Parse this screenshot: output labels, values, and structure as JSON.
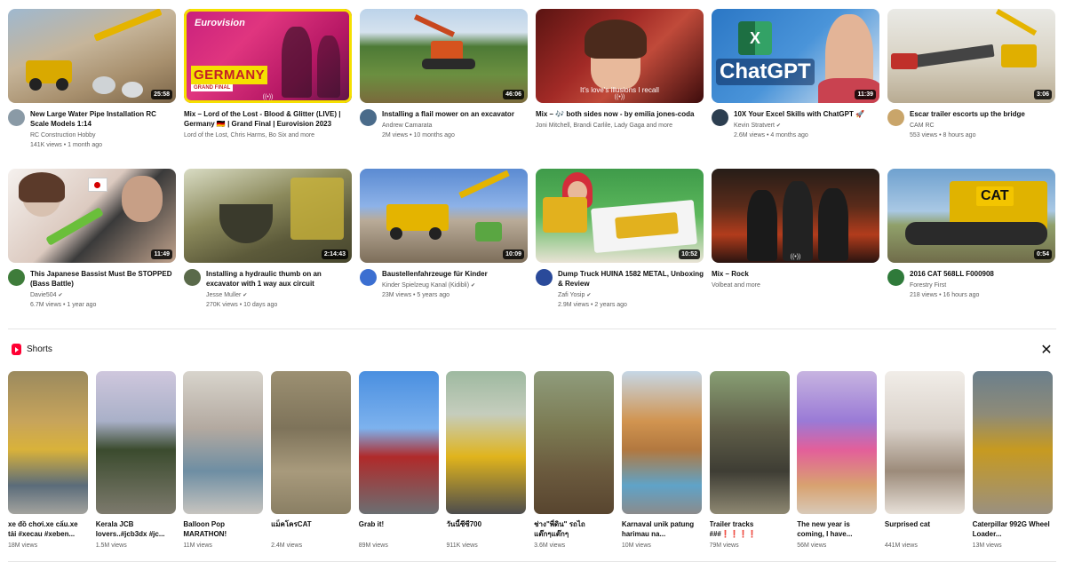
{
  "videos": [
    {
      "title": "New Large Water Pipe Installation RC Scale Models 1:14",
      "channel": "RC Construction Hobby",
      "views": "141K views",
      "age": "1 month ago",
      "duration": "25:58",
      "avatar_color": "#8a9aa6",
      "verified": false
    },
    {
      "title": "Mix – Lord of the Lost - Blood & Glitter (LIVE) | Germany 🇩🇪 | Grand Final | Eurovision 2023",
      "channel": "Lord of the Lost, Chris Harms, Bo Six and more",
      "views": "",
      "age": "",
      "duration": "",
      "avatar_color": "",
      "verified": false,
      "is_mix": true,
      "thumb_text": {
        "brand": "Eurovision",
        "word": "GERMANY",
        "sub": "GRAND FINAL"
      }
    },
    {
      "title": "Installing a flail mower on an excavator",
      "channel": "Andrew Camarata",
      "views": "2M views",
      "age": "10 months ago",
      "duration": "46:06",
      "avatar_color": "#4a6b8a",
      "verified": false
    },
    {
      "title": "Mix – 🎶 both sides now - by emilia jones-coda",
      "channel": "Joni Mitchell, Brandi Carlile, Lady Gaga and more",
      "views": "",
      "age": "",
      "duration": "",
      "avatar_color": "",
      "verified": false,
      "is_mix": true,
      "thumb_text": {
        "lyrics": "It's love's illusions I recall"
      }
    },
    {
      "title": "10X Your Excel Skills with ChatGPT 🚀",
      "channel": "Kevin Stratvert",
      "views": "2.6M views",
      "age": "4 months ago",
      "duration": "11:39",
      "avatar_color": "#2c3e50",
      "verified": true,
      "thumb_text": {
        "word": "ChatGPT",
        "icon": "X"
      }
    },
    {
      "title": "Escar trailer escorts up the bridge",
      "channel": "CAM RC",
      "views": "553 views",
      "age": "8 hours ago",
      "duration": "3:06",
      "avatar_color": "#c9a56a",
      "verified": false
    },
    {
      "title": "This Japanese Bassist Must Be STOPPED (Bass Battle)",
      "channel": "Davie504",
      "views": "6.7M views",
      "age": "1 year ago",
      "duration": "11:49",
      "avatar_color": "#3e7c3a",
      "verified": true
    },
    {
      "title": "Installing a hydraulic thumb on an excavator with 1 way aux circuit",
      "channel": "Jesse Muller",
      "views": "270K views",
      "age": "10 days ago",
      "duration": "2:14:43",
      "avatar_color": "#5a6a4a",
      "verified": true
    },
    {
      "title": "Baustellenfahrzeuge für Kinder",
      "channel": "Kinder Spielzeug Kanal (Kidibli)",
      "views": "23M views",
      "age": "5 years ago",
      "duration": "10:09",
      "avatar_color": "#3b6fd1",
      "verified": true
    },
    {
      "title": "Dump Truck HUINA 1582 METAL, Unboxing & Review",
      "channel": "Zafi Yosip",
      "views": "2.9M views",
      "age": "2 years ago",
      "duration": "10:52",
      "avatar_color": "#2a4a9a",
      "verified": true
    },
    {
      "title": "Mix – Rock",
      "channel": "Volbeat and more",
      "views": "",
      "age": "",
      "duration": "",
      "avatar_color": "",
      "verified": false,
      "is_mix": true
    },
    {
      "title": "2016 CAT 568LL F000908",
      "channel": "Forestry First",
      "views": "218 views",
      "age": "16 hours ago",
      "duration": "0:54",
      "avatar_color": "#2f7a3a",
      "verified": false,
      "thumb_text": {
        "word": "CAT"
      }
    }
  ],
  "shorts_section": {
    "title": "Shorts",
    "close_label": "✕"
  },
  "shorts": [
    {
      "title": "xe đồ chơi.xe cẩu.xe tải #xecau #xeben...",
      "views": "18M views"
    },
    {
      "title": "Kerala JCB lovers..#jcb3dx #jc...",
      "views": "1.5M views"
    },
    {
      "title": "Balloon Pop MARATHON!",
      "views": "11M views"
    },
    {
      "title": "แม็คโครCAT",
      "views": "2.4M views"
    },
    {
      "title": "Grab it!",
      "views": "89M views"
    },
    {
      "title": "วันนี้ซีซี700",
      "views": "911K views"
    },
    {
      "title": "ช่าง\"พี่ดิน\" รถไถ แต๊กๆแต๊กๆ",
      "views": "3.6M views"
    },
    {
      "title": "Karnaval unik patung harimau na...",
      "views": "10M views"
    },
    {
      "title": "Trailer tracks ###❗❗❗❗",
      "views": "79M views"
    },
    {
      "title": "The new year is coming, I have...",
      "views": "56M views"
    },
    {
      "title": "Surprised cat",
      "views": "441M views"
    },
    {
      "title": "Caterpillar 992G Wheel Loader...",
      "views": "13M views"
    }
  ]
}
